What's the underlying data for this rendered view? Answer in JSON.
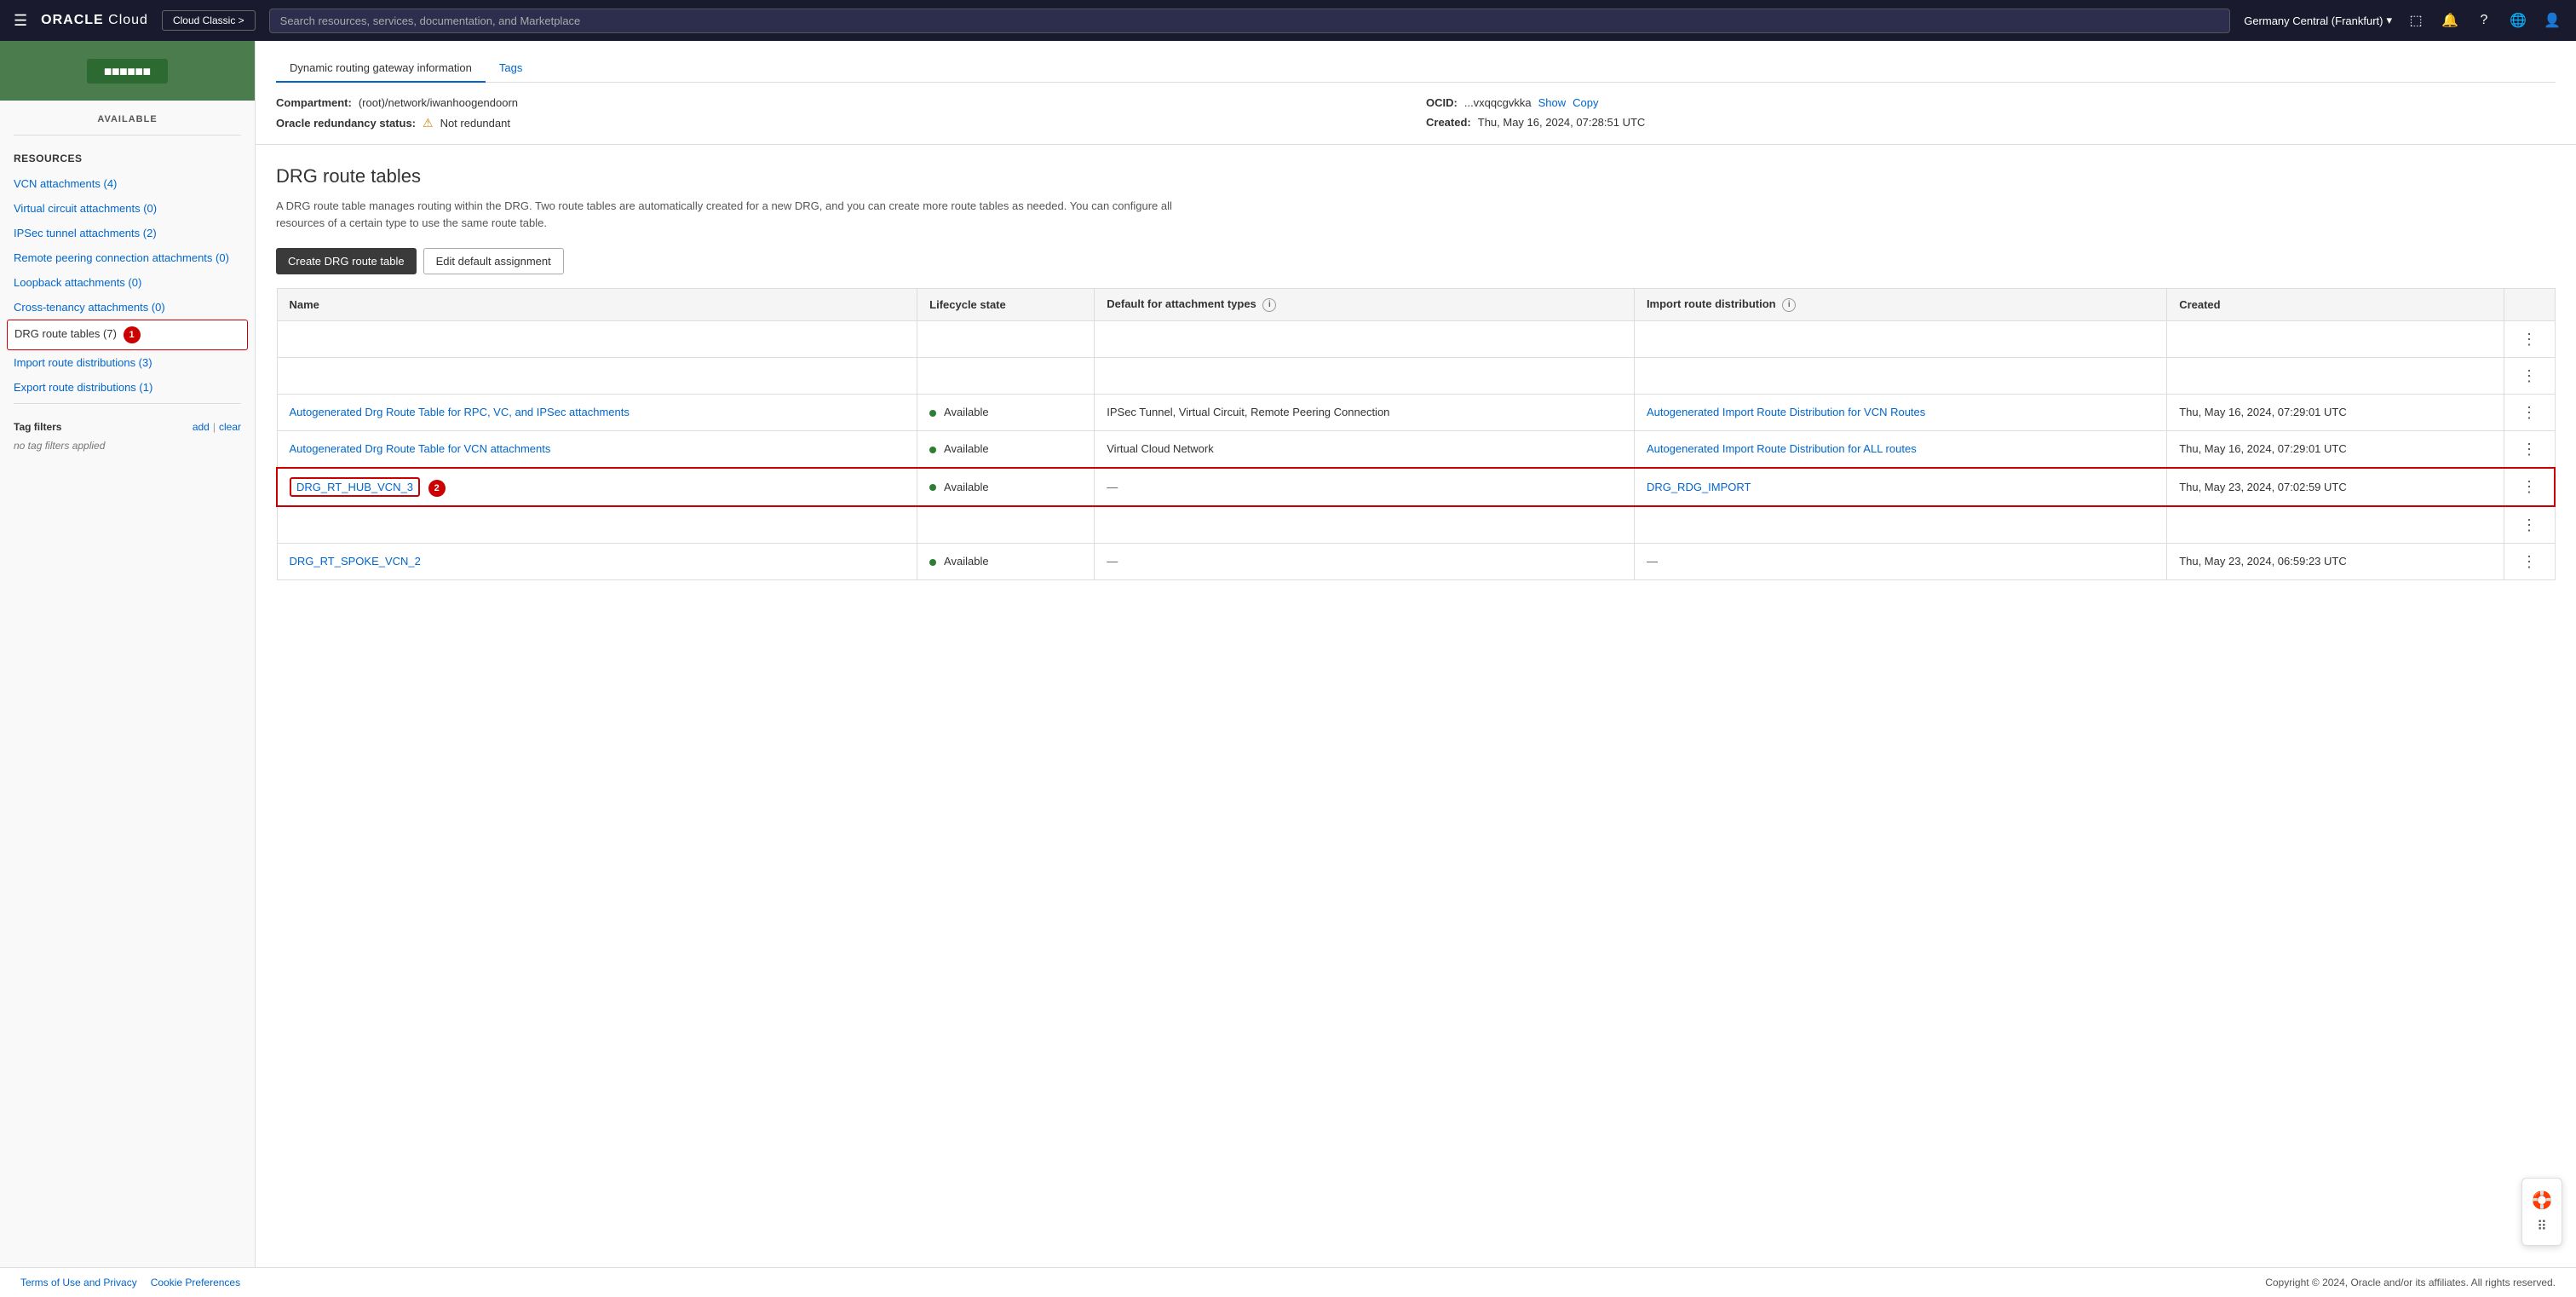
{
  "nav": {
    "hamburger": "☰",
    "logo_text": "ORACLE",
    "logo_suffix": " Cloud",
    "classic_btn": "Cloud Classic >",
    "search_placeholder": "Search resources, services, documentation, and Marketplace",
    "region": "Germany Central (Frankfurt)",
    "region_icon": "▾"
  },
  "sidebar": {
    "available_label": "AVAILABLE",
    "resources_title": "Resources",
    "links": [
      {
        "label": "VCN attachments (4)",
        "id": "vcn-attachments"
      },
      {
        "label": "Virtual circuit attachments (0)",
        "id": "virtual-circuit"
      },
      {
        "label": "IPSec tunnel attachments (2)",
        "id": "ipsec-tunnel"
      },
      {
        "label": "Remote peering connection attachments (0)",
        "id": "remote-peering"
      },
      {
        "label": "Loopback attachments (0)",
        "id": "loopback"
      },
      {
        "label": "Cross-tenancy attachments (0)",
        "id": "cross-tenancy"
      }
    ],
    "active_link": "DRG route tables (7)",
    "active_badge": "1",
    "sub_links": [
      {
        "label": "Import route distributions (3)",
        "id": "import-route"
      },
      {
        "label": "Export route distributions (1)",
        "id": "export-route"
      }
    ],
    "tag_filters_title": "Tag filters",
    "tag_add": "add",
    "tag_separator": "|",
    "tag_clear": "clear",
    "tag_no_filters": "no tag filters applied"
  },
  "info_panel": {
    "tabs": [
      {
        "label": "Dynamic routing gateway information",
        "active": true
      },
      {
        "label": "Tags",
        "active": false
      }
    ],
    "compartment_label": "Compartment:",
    "compartment_value": "(root)/network/iwanhoogendoorn",
    "ocid_label": "OCID:",
    "ocid_value": "...vxqqcgvkka",
    "ocid_show": "Show",
    "ocid_copy": "Copy",
    "redundancy_label": "Oracle redundancy status:",
    "redundancy_warning": "⚠",
    "redundancy_value": "Not redundant",
    "created_label": "Created:",
    "created_value": "Thu, May 16, 2024, 07:28:51 UTC"
  },
  "drg": {
    "title": "DRG route tables",
    "description": "A DRG route table manages routing within the DRG. Two route tables are automatically created for a new DRG, and you can create more route tables as needed. You can configure all resources of a certain type to use the same route table.",
    "create_btn": "Create DRG route table",
    "edit_btn": "Edit default assignment",
    "table": {
      "columns": [
        {
          "label": "Name",
          "key": "name"
        },
        {
          "label": "Lifecycle state",
          "key": "lifecycle"
        },
        {
          "label": "Default for attachment types",
          "key": "default_attachment",
          "has_info": true
        },
        {
          "label": "Import route distribution",
          "key": "import_dist",
          "has_info": true
        },
        {
          "label": "Created",
          "key": "created"
        }
      ],
      "rows": [
        {
          "id": "empty1",
          "empty": true
        },
        {
          "id": "empty2",
          "empty": true
        },
        {
          "id": "row1",
          "name": "Autogenerated Drg Route Table for RPC, VC, and IPSec attachments",
          "lifecycle": "Available",
          "default_attachment": "IPSec Tunnel, Virtual Circuit, Remote Peering Connection",
          "import_dist": "Autogenerated Import Route Distribution for VCN Routes",
          "import_dist_link": true,
          "created": "Thu, May 16, 2024, 07:29:01 UTC",
          "highlighted": false
        },
        {
          "id": "row2",
          "name": "Autogenerated Drg Route Table for VCN attachments",
          "lifecycle": "Available",
          "default_attachment": "Virtual Cloud Network",
          "import_dist": "Autogenerated Import Route Distribution for ALL routes",
          "import_dist_link": true,
          "created": "Thu, May 16, 2024, 07:29:01 UTC",
          "highlighted": false
        },
        {
          "id": "row3",
          "name": "DRG_RT_HUB_VCN_3",
          "lifecycle": "Available",
          "default_attachment": "—",
          "import_dist": "DRG_RDG_IMPORT",
          "import_dist_link": true,
          "created": "Thu, May 23, 2024, 07:02:59 UTC",
          "highlighted": true,
          "badge": "2"
        },
        {
          "id": "empty3",
          "empty": true
        },
        {
          "id": "row4",
          "name": "DRG_RT_SPOKE_VCN_2",
          "lifecycle": "Available",
          "default_attachment": "—",
          "import_dist": "—",
          "import_dist_link": false,
          "created": "Thu, May 23, 2024, 06:59:23 UTC",
          "highlighted": false
        }
      ]
    }
  },
  "footer": {
    "terms": "Terms of Use and Privacy",
    "cookies": "Cookie Preferences",
    "copyright": "Copyright © 2024, Oracle and/or its affiliates. All rights reserved."
  }
}
